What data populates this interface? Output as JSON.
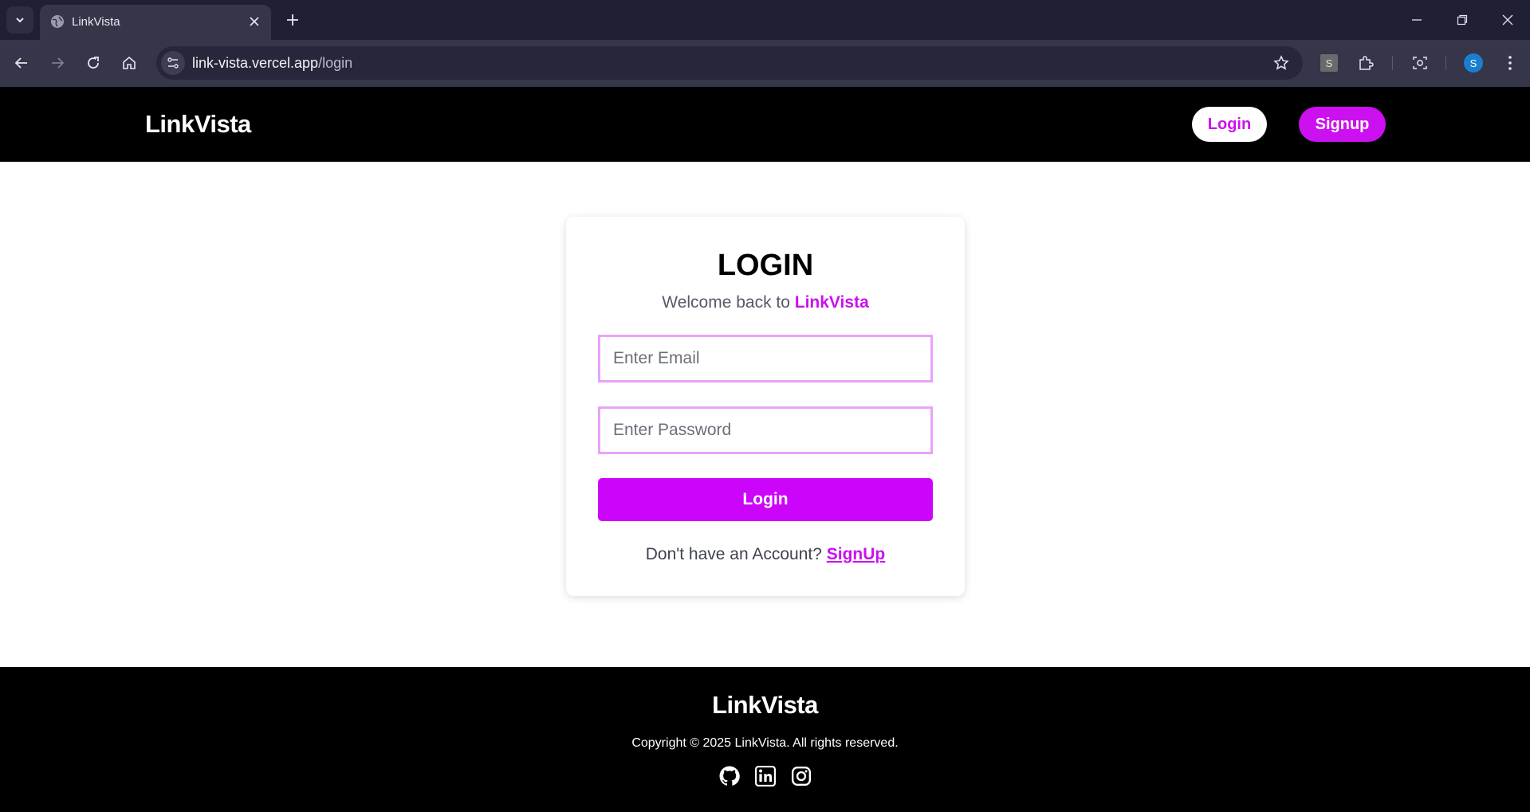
{
  "browser": {
    "tab_title": "LinkVista",
    "url_host": "link-vista.vercel.app",
    "url_path": "/login",
    "extension_letter": "S",
    "profile_initial": "S"
  },
  "header": {
    "brand": "LinkVista",
    "login_label": "Login",
    "signup_label": "Signup"
  },
  "login_card": {
    "title": "LOGIN",
    "welcome_prefix": "Welcome back to ",
    "welcome_brand": "LinkVista",
    "email_placeholder": "Enter Email",
    "password_placeholder": "Enter Password",
    "submit_label": "Login",
    "switch_prompt": "Don't have an Account? ",
    "switch_link": "SignUp"
  },
  "footer": {
    "brand": "LinkVista",
    "copyright": "Copyright © 2025 LinkVista. All rights reserved.",
    "socials": [
      "github-icon",
      "linkedin-icon",
      "instagram-icon"
    ]
  },
  "colors": {
    "accent": "#cc10f0",
    "header_bg": "#000000",
    "input_border": "#e9a3f7"
  }
}
